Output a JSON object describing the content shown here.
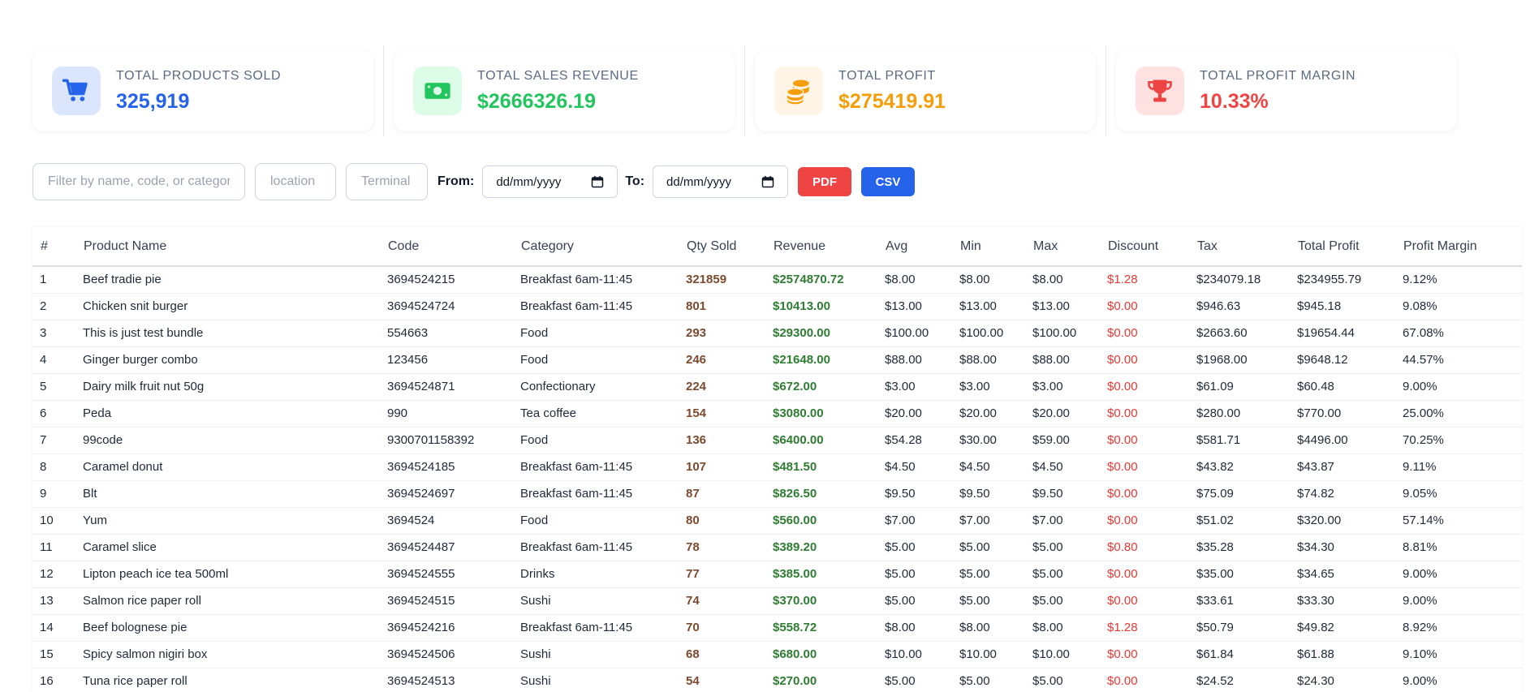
{
  "summary": {
    "cards": [
      {
        "label": "TOTAL PRODUCTS SOLD",
        "value": "325,919",
        "icon": "cart-icon",
        "value_color": "#2563eb",
        "icon_bg": "#dbe6fd",
        "icon_color": "#2563eb"
      },
      {
        "label": "TOTAL SALES REVENUE",
        "value": "$2666326.19",
        "icon": "money-icon",
        "value_color": "#22c55e",
        "icon_bg": "#dcfce7",
        "icon_color": "#22c55e"
      },
      {
        "label": "TOTAL PROFIT",
        "value": "$275419.91",
        "icon": "coins-icon",
        "value_color": "#f59e0b",
        "icon_bg": "#fff4e5",
        "icon_color": "#f59e0b"
      },
      {
        "label": "TOTAL PROFIT MARGIN",
        "value": "10.33%",
        "icon": "trophy-icon",
        "value_color": "#ef4444",
        "icon_bg": "#fee2e2",
        "icon_color": "#ef4444"
      }
    ]
  },
  "filters": {
    "search_placeholder": "Filter by name, code, or category",
    "location_placeholder": "location",
    "terminal_placeholder": "Terminal",
    "from_label": "From:",
    "to_label": "To:",
    "date_placeholder": "dd/mm/yyyy",
    "pdf_label": "PDF",
    "csv_label": "CSV",
    "pdf_color": "#ef4444",
    "csv_color": "#2563eb"
  },
  "table": {
    "headers": [
      "#",
      "Product Name",
      "Code",
      "Category",
      "Qty Sold",
      "Revenue",
      "Avg",
      "Min",
      "Max",
      "Discount",
      "Tax",
      "Total Profit",
      "Profit Margin"
    ],
    "rows": [
      [
        "1",
        "Beef tradie pie",
        "3694524215",
        "Breakfast 6am-11:45",
        "321859",
        "$2574870.72",
        "$8.00",
        "$8.00",
        "$8.00",
        "$1.28",
        "$234079.18",
        "$234955.79",
        "9.12%"
      ],
      [
        "2",
        "Chicken snit burger",
        "3694524724",
        "Breakfast 6am-11:45",
        "801",
        "$10413.00",
        "$13.00",
        "$13.00",
        "$13.00",
        "$0.00",
        "$946.63",
        "$945.18",
        "9.08%"
      ],
      [
        "3",
        "This is just test bundle",
        "554663",
        "Food",
        "293",
        "$29300.00",
        "$100.00",
        "$100.00",
        "$100.00",
        "$0.00",
        "$2663.60",
        "$19654.44",
        "67.08%"
      ],
      [
        "4",
        "Ginger burger combo",
        "123456",
        "Food",
        "246",
        "$21648.00",
        "$88.00",
        "$88.00",
        "$88.00",
        "$0.00",
        "$1968.00",
        "$9648.12",
        "44.57%"
      ],
      [
        "5",
        "Dairy milk fruit nut 50g",
        "3694524871",
        "Confectionary",
        "224",
        "$672.00",
        "$3.00",
        "$3.00",
        "$3.00",
        "$0.00",
        "$61.09",
        "$60.48",
        "9.00%"
      ],
      [
        "6",
        "Peda",
        "990",
        "Tea coffee",
        "154",
        "$3080.00",
        "$20.00",
        "$20.00",
        "$20.00",
        "$0.00",
        "$280.00",
        "$770.00",
        "25.00%"
      ],
      [
        "7",
        "99code",
        "9300701158392",
        "Food",
        "136",
        "$6400.00",
        "$54.28",
        "$30.00",
        "$59.00",
        "$0.00",
        "$581.71",
        "$4496.00",
        "70.25%"
      ],
      [
        "8",
        "Caramel donut",
        "3694524185",
        "Breakfast 6am-11:45",
        "107",
        "$481.50",
        "$4.50",
        "$4.50",
        "$4.50",
        "$0.00",
        "$43.82",
        "$43.87",
        "9.11%"
      ],
      [
        "9",
        "Blt",
        "3694524697",
        "Breakfast 6am-11:45",
        "87",
        "$826.50",
        "$9.50",
        "$9.50",
        "$9.50",
        "$0.00",
        "$75.09",
        "$74.82",
        "9.05%"
      ],
      [
        "10",
        "Yum",
        "3694524",
        "Food",
        "80",
        "$560.00",
        "$7.00",
        "$7.00",
        "$7.00",
        "$0.00",
        "$51.02",
        "$320.00",
        "57.14%"
      ],
      [
        "11",
        "Caramel slice",
        "3694524487",
        "Breakfast 6am-11:45",
        "78",
        "$389.20",
        "$5.00",
        "$5.00",
        "$5.00",
        "$0.80",
        "$35.28",
        "$34.30",
        "8.81%"
      ],
      [
        "12",
        "Lipton peach ice tea 500ml",
        "3694524555",
        "Drinks",
        "77",
        "$385.00",
        "$5.00",
        "$5.00",
        "$5.00",
        "$0.00",
        "$35.00",
        "$34.65",
        "9.00%"
      ],
      [
        "13",
        "Salmon rice paper roll",
        "3694524515",
        "Sushi",
        "74",
        "$370.00",
        "$5.00",
        "$5.00",
        "$5.00",
        "$0.00",
        "$33.61",
        "$33.30",
        "9.00%"
      ],
      [
        "14",
        "Beef bolognese pie",
        "3694524216",
        "Breakfast 6am-11:45",
        "70",
        "$558.72",
        "$8.00",
        "$8.00",
        "$8.00",
        "$1.28",
        "$50.79",
        "$49.82",
        "8.92%"
      ],
      [
        "15",
        "Spicy salmon nigiri box",
        "3694524506",
        "Sushi",
        "68",
        "$680.00",
        "$10.00",
        "$10.00",
        "$10.00",
        "$0.00",
        "$61.84",
        "$61.88",
        "9.10%"
      ],
      [
        "16",
        "Tuna rice paper roll",
        "3694524513",
        "Sushi",
        "54",
        "$270.00",
        "$5.00",
        "$5.00",
        "$5.00",
        "$0.00",
        "$24.52",
        "$24.30",
        "9.00%"
      ]
    ]
  }
}
